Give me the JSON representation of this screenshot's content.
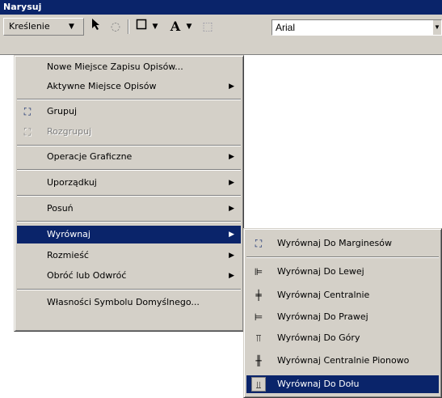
{
  "window": {
    "title": "Narysuj"
  },
  "toolbar": {
    "kreslenie_label": "Kreślenie",
    "icons": [
      "chevron-down-icon",
      "select-arrow-icon",
      "rotate-icon",
      "rectangle-icon",
      "dropdown-icon",
      "text-a-icon",
      "dropdown-icon",
      "edit-points-icon"
    ],
    "font_value": "Arial"
  },
  "menu": {
    "items": [
      {
        "label": "Nowe Miejsce Zapisu Opisów..."
      },
      {
        "label": "Aktywne Miejsce Opisów",
        "submenu": true
      },
      {
        "label": "Grupuj",
        "icon": "group-icon"
      },
      {
        "label": "Rozgrupuj",
        "icon": "ungroup-icon",
        "disabled": true
      },
      {
        "label": "Operacje Graficzne",
        "submenu": true
      },
      {
        "label": "Uporządkuj",
        "submenu": true
      },
      {
        "label": "Posuń",
        "submenu": true
      },
      {
        "label": "Wyrównaj",
        "submenu": true,
        "highlighted": true
      },
      {
        "label": "Rozmieść",
        "submenu": true
      },
      {
        "label": "Obróć lub Odwróć",
        "submenu": true
      },
      {
        "label": "Własności Symbolu Domyślnego..."
      }
    ]
  },
  "submenu": {
    "items": [
      {
        "label": "Wyrównaj Do Marginesów",
        "icon": "align-margins-icon"
      },
      {
        "label": "Wyrównaj Do Lewej",
        "icon": "align-left-icon"
      },
      {
        "label": "Wyrównaj Centralnie",
        "icon": "align-center-icon"
      },
      {
        "label": "Wyrównaj Do Prawej",
        "icon": "align-right-icon"
      },
      {
        "label": "Wyrównaj Do Góry",
        "icon": "align-top-icon"
      },
      {
        "label": "Wyrównaj Centralnie Pionowo",
        "icon": "align-middle-icon"
      },
      {
        "label": "Wyrównaj Do Dołu",
        "icon": "align-bottom-icon",
        "highlighted": true
      }
    ]
  },
  "colors": {
    "menu_bg": "#d4d0c8",
    "highlight": "#0a246a",
    "title_bg": "#0a246a"
  }
}
